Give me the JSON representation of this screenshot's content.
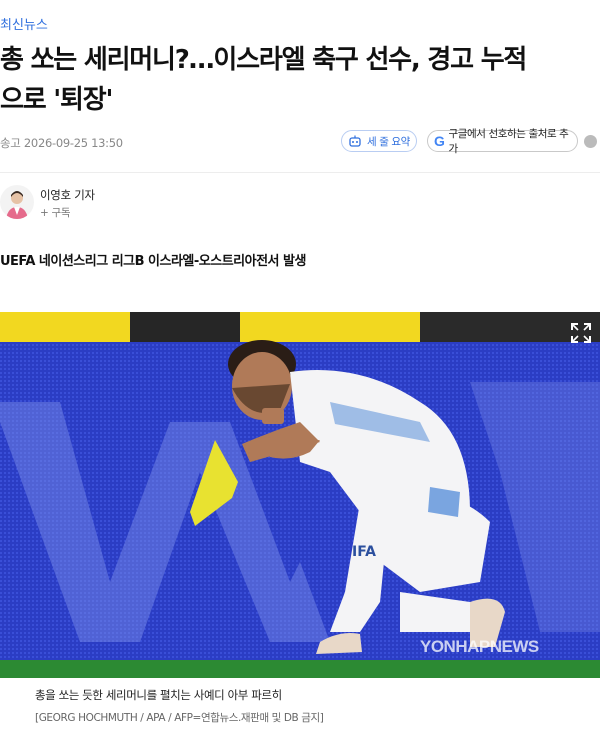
{
  "category": "최신뉴스",
  "headline_line1": "총 쏘는 세리머니?…이스라엘 축구 선수, 경고 누적",
  "headline_line2": "으로 '퇴장'",
  "meta": {
    "date": "송고 2026-09-25 13:50",
    "summary_label": "세 줄 요약",
    "google_label": "구글에서 선호하는 출처로 추가"
  },
  "reporter": {
    "name": "이영호 기자",
    "subscribe": "+ 구독"
  },
  "subhead": "UEFA 네이션스리그 리그B 이스라엘-오스트리아전서 발생",
  "photo": {
    "watermark": "YONHAPNEWS",
    "caption": "총을 쏘는 듯한 세리머니를 펼치는 사예디 아부 파르히",
    "credit": "[GEORG HOCHMUTH / APA / AFP=연합뉴스.재판매 및 DB 금지]"
  },
  "colors": {
    "link": "#2f6fde",
    "board": "#2b3dc4",
    "pitch": "#2c8a33",
    "flag": "#e8e230"
  },
  "icons": [
    "robot-summary-icon",
    "google-logo-icon",
    "more-icon",
    "reporter-avatar",
    "expand-icon"
  ]
}
